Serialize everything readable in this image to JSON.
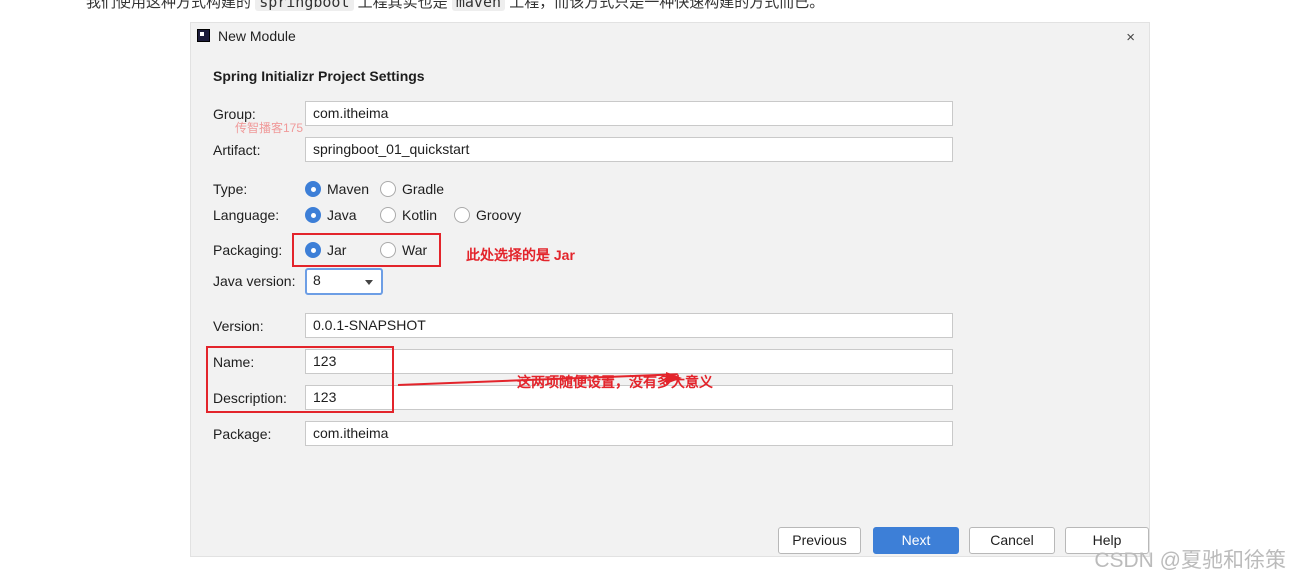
{
  "background_text": {
    "lead": "我们使用这种方式构建的",
    "code1": "springboot",
    "mid": "工程其实也是",
    "code2": "maven",
    "tail": "工程，而该方式只是一种快速构建的方式而已。"
  },
  "dialog": {
    "title": "New Module",
    "close": "×",
    "section_title": "Spring Initializr Project Settings"
  },
  "fields": {
    "group": {
      "label": "Group:",
      "value": "com.itheima"
    },
    "artifact": {
      "label": "Artifact:",
      "value": "springboot_01_quickstart"
    },
    "version": {
      "label": "Version:",
      "value": "0.0.1-SNAPSHOT"
    },
    "name": {
      "label": "Name:",
      "value": "123"
    },
    "description": {
      "label": "Description:",
      "value": "123"
    },
    "package": {
      "label": "Package:",
      "value": "com.itheima"
    }
  },
  "type": {
    "label": "Type:",
    "options": [
      "Maven",
      "Gradle"
    ],
    "selected": "Maven"
  },
  "language": {
    "label": "Language:",
    "options": [
      "Java",
      "Kotlin",
      "Groovy"
    ],
    "selected": "Java"
  },
  "packaging": {
    "label": "Packaging:",
    "options": [
      "Jar",
      "War"
    ],
    "selected": "Jar"
  },
  "java_version": {
    "label": "Java version:",
    "value": "8"
  },
  "annotations": {
    "packaging_note": "此处选择的是 Jar",
    "name_desc_note": "这两项随便设置，没有多大意义",
    "watermark": "传智播客175"
  },
  "buttons": {
    "previous": "Previous",
    "next": "Next",
    "cancel": "Cancel",
    "help": "Help"
  },
  "footer": {
    "csdn": "CSDN @夏驰和徐策"
  },
  "colors": {
    "accent": "#3d7fd7",
    "annotation": "#e3242b",
    "dialog_bg": "#f2f2f2"
  }
}
